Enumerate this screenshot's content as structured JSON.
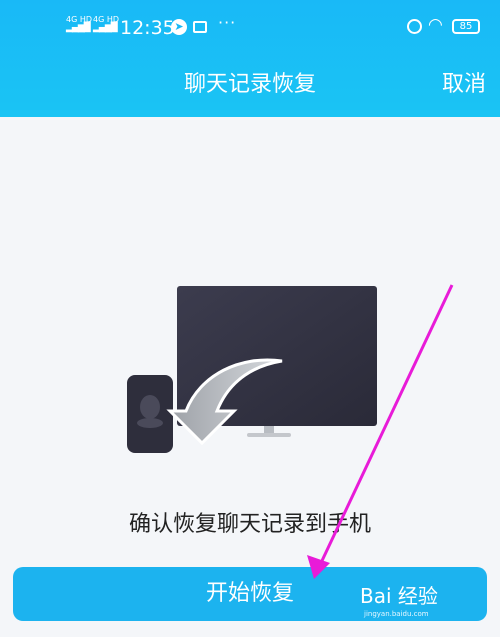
{
  "status_bar": {
    "net1": "4G HD",
    "net2": "4G HD",
    "time": "12:35",
    "battery": "85"
  },
  "header": {
    "title": "聊天记录恢复",
    "cancel_label": "取消"
  },
  "main": {
    "confirm_text": "确认恢复聊天记录到手机",
    "start_button_label": "开始恢复"
  },
  "watermark": {
    "brand": "Bai 经验",
    "url": "jingyan.baidu.com"
  },
  "colors": {
    "header": "#19b9f7",
    "button": "#1cb3ef",
    "annotation_arrow": "#e81bd8"
  }
}
